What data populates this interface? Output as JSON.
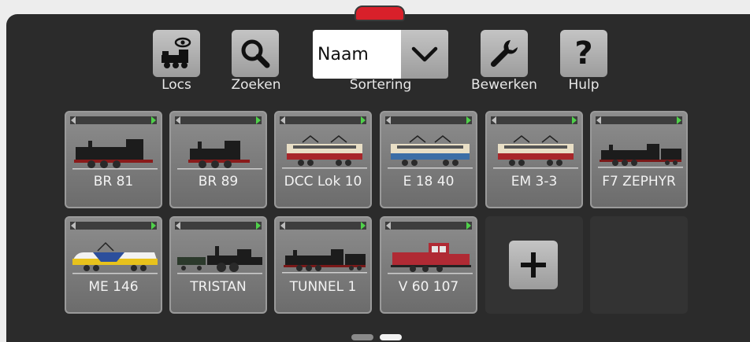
{
  "toolbar": {
    "locs_label": "Locs",
    "search_label": "Zoeken",
    "sort_label": "Sortering",
    "sort_value": "Naam",
    "edit_label": "Bewerken",
    "help_label": "Hulp"
  },
  "locomotives": [
    {
      "name": "BR 81",
      "icon": "steam-tank-loco"
    },
    {
      "name": "BR 89",
      "icon": "small-steam-loco"
    },
    {
      "name": "DCC Lok 10",
      "icon": "electric-loco-cream-red"
    },
    {
      "name": "E 18 40",
      "icon": "electric-loco-cream-blue"
    },
    {
      "name": "EM 3-3",
      "icon": "electric-loco-cream-red"
    },
    {
      "name": "F7 ZEPHYR",
      "icon": "steam-tender-loco"
    },
    {
      "name": "ME 146",
      "icon": "electric-loco-yellow-blue"
    },
    {
      "name": "TRISTAN",
      "icon": "vintage-steam-loco"
    },
    {
      "name": "TUNNEL 1",
      "icon": "steam-tender-loco"
    },
    {
      "name": "V 60 107",
      "icon": "diesel-shunter-red"
    }
  ],
  "colors": {
    "accent_red": "#d8202a",
    "speed_arrow_green": "#4fd14a"
  },
  "pager": {
    "pages": 2,
    "current": 2
  }
}
